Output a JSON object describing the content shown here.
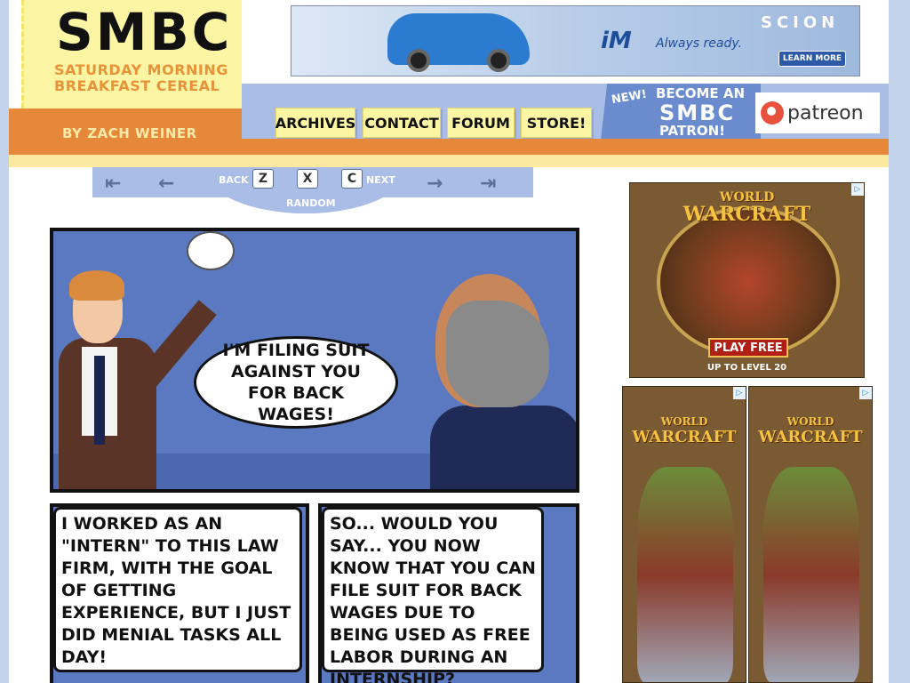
{
  "header": {
    "logo_title": "SMBC",
    "logo_subtitle": "SATURDAY MORNING BREAKFAST CEREAL",
    "byline": "BY ZACH WEINER"
  },
  "top_ad": {
    "brand": "SCION",
    "model": "iM",
    "tagline": "Always ready.",
    "cta": "LEARN MORE"
  },
  "nav": {
    "tabs": [
      "ARCHIVES",
      "CONTACT",
      "FORUM",
      "STORE!"
    ]
  },
  "patreon_promo": {
    "new": "NEW!",
    "line1": "BECOME AN",
    "line2": "SMBC",
    "line3": "PATRON!",
    "logo_text": "patreon"
  },
  "comic_nav": {
    "first_arrow": "⇤",
    "prev_arrow": "←",
    "back_label": "BACK",
    "next_label": "NEXT",
    "random_label": "RANDOM",
    "key_back": "Z",
    "key_random": "X",
    "key_next": "C",
    "next_arrow": "→",
    "last_arrow": "⇥"
  },
  "comic": {
    "panel1_speech": "I'M FILING SUIT AGAINST YOU FOR BACK WAGES!",
    "panel2_caption": "I WORKED AS AN \"INTERN\" TO THIS LAW FIRM, WITH THE GOAL OF GETTING EXPERIENCE, BUT I JUST DID MENIAL TASKS ALL DAY!",
    "panel3_caption": "SO... WOULD YOU SAY... YOU NOW KNOW THAT YOU CAN FILE SUIT FOR BACK WAGES DUE TO BEING USED AS FREE LABOR DURING AN INTERNSHIP?"
  },
  "side_ads": {
    "wow_top": {
      "logo_line1": "WORLD",
      "logo_line2": "WARCRAFT",
      "button": "PLAY FREE",
      "level": "UP TO LEVEL 20"
    },
    "wow_bottom_left": {
      "logo_line1": "WORLD",
      "logo_line2": "WARCRAFT"
    },
    "wow_bottom_right": {
      "logo_line1": "WORLD",
      "logo_line2": "WARCRAFT"
    },
    "adchoice_icon": "▷"
  },
  "colors": {
    "orange": "#e5883a",
    "yellow": "#fcf6a4",
    "nav_blue": "#a9bde6",
    "comic_blue": "#5b79c0"
  }
}
